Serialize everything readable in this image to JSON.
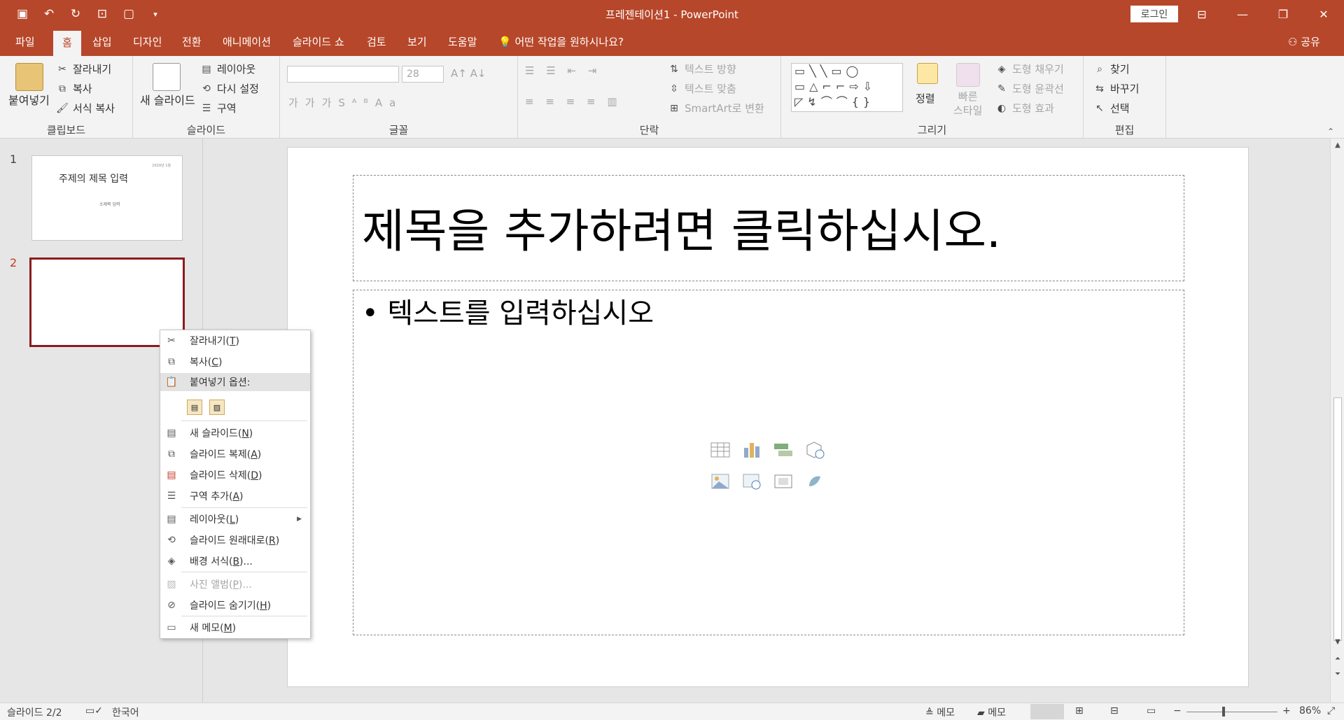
{
  "app": {
    "title": "프레젠테이션1  -  PowerPoint",
    "login_label": "로그인",
    "share_label": "공유"
  },
  "tabs": [
    {
      "label": "파일"
    },
    {
      "label": "홈"
    },
    {
      "label": "삽입"
    },
    {
      "label": "디자인"
    },
    {
      "label": "전환"
    },
    {
      "label": "애니메이션"
    },
    {
      "label": "슬라이드 쇼"
    },
    {
      "label": "검토"
    },
    {
      "label": "보기"
    },
    {
      "label": "도움말"
    }
  ],
  "tell_me": "어떤 작업을 원하시나요?",
  "ribbon": {
    "clipboard": {
      "paste": "붙여넣기",
      "cut": "잘라내기",
      "copy": "복사",
      "format_painter": "서식 복사",
      "label": "클립보드"
    },
    "slides": {
      "new_slide": "새 슬라이드",
      "layout": "레이아웃",
      "reset": "다시 설정",
      "section": "구역",
      "label": "슬라이드"
    },
    "font": {
      "size": "28",
      "label": "글꼴"
    },
    "paragraph": {
      "text_direction": "텍스트 방향",
      "align_text": "텍스트 맞춤",
      "smartart": "SmartArt로 변환",
      "label": "단락"
    },
    "drawing": {
      "arrange": "정렬",
      "quick_styles": "빠른\n스타일",
      "fill": "도형 채우기",
      "outline": "도형 윤곽선",
      "effects": "도형 효과",
      "label": "그리기"
    },
    "editing": {
      "find": "찾기",
      "replace": "바꾸기",
      "select": "선택",
      "label": "편집"
    }
  },
  "thumbnails": [
    {
      "number": "1",
      "title": "주제의 제목 입력",
      "subtitle": "소제목 입력",
      "date": "2020년 1월"
    },
    {
      "number": "2"
    }
  ],
  "slide": {
    "title_placeholder": "제목을 추가하려면 클릭하십시오.",
    "content_placeholder": "텍스트를 입력하십시오"
  },
  "context_menu": {
    "cut": {
      "label": "잘라내기(",
      "key": "T",
      "end": ")"
    },
    "copy": {
      "label": "복사(",
      "key": "C",
      "end": ")"
    },
    "paste_options": "붙여넣기 옵션:",
    "new_slide": {
      "label": "새 슬라이드(",
      "key": "N",
      "end": ")"
    },
    "duplicate": {
      "label": "슬라이드 복제(",
      "key": "A",
      "end": ")"
    },
    "delete": {
      "label": "슬라이드 삭제(",
      "key": "D",
      "end": ")"
    },
    "add_section": {
      "label": "구역 추가(",
      "key": "A",
      "end": ")"
    },
    "layout": {
      "label": "레이아웃(",
      "key": "L",
      "end": ")"
    },
    "reset": {
      "label": "슬라이드 원래대로(",
      "key": "R",
      "end": ")"
    },
    "format_bg": {
      "label": "배경 서식(",
      "key": "B",
      "end": ")..."
    },
    "photo_album": {
      "label": "사진 앨범(",
      "key": "P",
      "end": ")..."
    },
    "hide": {
      "label": "슬라이드 숨기기(",
      "key": "H",
      "end": ")"
    },
    "new_comment": {
      "label": "새 메모(",
      "key": "M",
      "end": ")"
    }
  },
  "status": {
    "slide_info": "슬라이드 2/2",
    "language": "한국어",
    "notes": "메모",
    "comments": "메모",
    "zoom": "86%"
  },
  "colors": {
    "accent": "#b7472a",
    "selection": "#8b1c1c"
  }
}
